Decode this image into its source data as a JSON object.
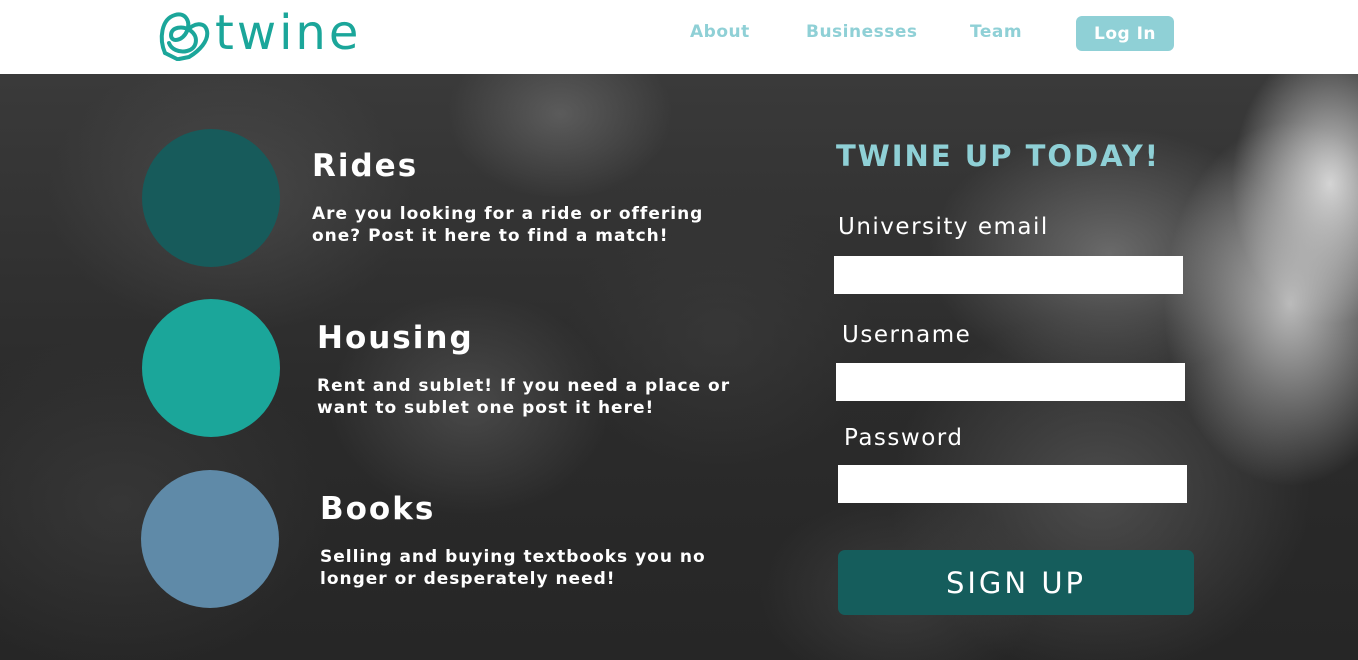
{
  "brand": {
    "name": "twine",
    "logo_icon": "heart-knot-icon",
    "color": "#1ba69a",
    "accent": "#8fd0d6"
  },
  "nav": {
    "about": "About",
    "businesses": "Businesses",
    "team": "Team",
    "login": "Log In"
  },
  "features": {
    "rides": {
      "title": "Rides",
      "description": "Are you looking for a ride or offering one? Post it here to find a match!",
      "color": "#175b5b"
    },
    "housing": {
      "title": "Housing",
      "description": "Rent and sublet! If you need a place or want to sublet one post it here!",
      "color": "#1ba69a"
    },
    "books": {
      "title": "Books",
      "description": "Selling and buying textbooks you no longer or desperately need!",
      "color": "#5f8aa8"
    }
  },
  "signup_form": {
    "heading": "TWINE UP TODAY!",
    "email_label": "University email",
    "email_value": "",
    "username_label": "Username",
    "username_value": "",
    "password_label": "Password",
    "password_value": "",
    "submit_label": "SIGN UP",
    "submit_color": "#155d5c"
  }
}
